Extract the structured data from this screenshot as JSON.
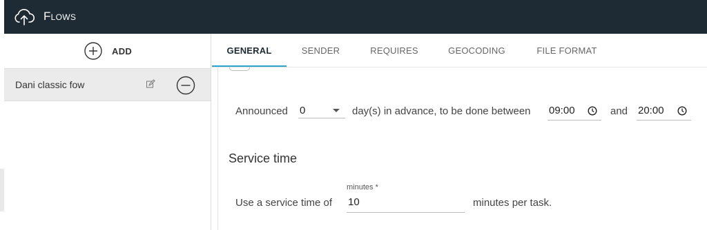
{
  "app": {
    "title": "Flows"
  },
  "sidebar": {
    "add_label": "ADD",
    "items": [
      {
        "label": "Dani classic fow"
      }
    ]
  },
  "tabs": [
    {
      "label": "GENERAL",
      "active": true
    },
    {
      "label": "SENDER"
    },
    {
      "label": "REQUIRES"
    },
    {
      "label": "GEOCODING"
    },
    {
      "label": "FILE FORMAT"
    }
  ],
  "general": {
    "announced_label": "Announced",
    "announced_days": "0",
    "announced_suffix": "day(s) in advance, to be done between",
    "start_time": "09:00",
    "and_label": "and",
    "end_time": "20:00",
    "service_title": "Service time",
    "service_prefix": "Use a service time of",
    "service_field_label": "minutes *",
    "service_minutes": "10",
    "service_suffix": "minutes per task."
  },
  "colors": {
    "topbar": "#1e2b35",
    "accent": "#29a7c8"
  },
  "icons": [
    "cloud-upload-icon",
    "add-circle-icon",
    "edit-icon",
    "remove-circle-icon",
    "chevron-down-icon",
    "clock-icon"
  ]
}
